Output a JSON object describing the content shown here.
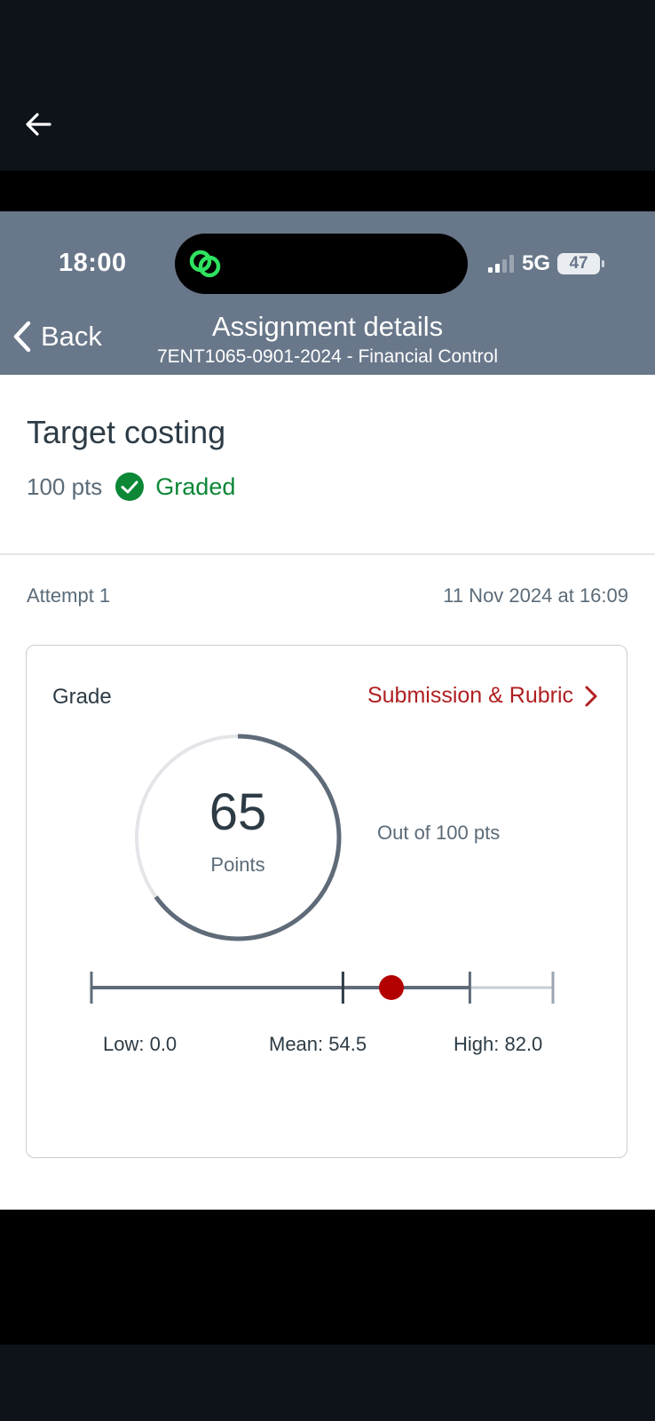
{
  "viewer": {
    "back_icon": "arrow-left-icon"
  },
  "status_bar": {
    "time": "18:00",
    "network": "5G",
    "battery": "47",
    "island_icon": "linked-rings-app-icon",
    "signal_icon": "signal-bars-icon"
  },
  "nav": {
    "back_label": "Back",
    "title": "Assignment details",
    "subtitle": "7ENT1065-0901-2024 - Financial Control"
  },
  "assignment": {
    "title": "Target costing",
    "points": "100 pts",
    "status": "Graded"
  },
  "attempt": {
    "label": "Attempt 1",
    "submitted": "11 Nov 2024 at 16:09"
  },
  "grade": {
    "label": "Grade",
    "link": "Submission & Rubric",
    "score": "65",
    "score_unit": "Points",
    "out_of": "Out of 100 pts",
    "score_fraction": 0.65,
    "stats": {
      "low_label": "Low: 0.0",
      "mean_label": "Mean: 54.5",
      "high_label": "High: 82.0",
      "low": 0.0,
      "mean": 54.5,
      "high": 82.0,
      "score": 65,
      "max": 100
    }
  },
  "colors": {
    "header_bg": "#69778a",
    "graded_green": "#0b8736",
    "link_red": "#b01f21",
    "score_dot": "#b30000",
    "ring_progress": "#5f6b78",
    "ring_track": "#e3e5e8"
  }
}
